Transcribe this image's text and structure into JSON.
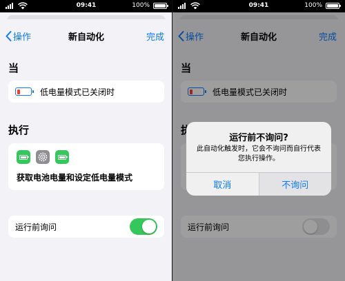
{
  "status_bar": {
    "time": "09:41",
    "battery_percent": "100%"
  },
  "nav": {
    "back_label": "操作",
    "title": "新自动化",
    "done_label": "完成"
  },
  "trigger_section": {
    "title": "当",
    "trigger_text": "低电量模式已关闭时"
  },
  "action_section": {
    "title": "执行",
    "action_text": "获取电池电量和设定低电量模式",
    "icons": [
      "battery-app-icon",
      "settings-gear-icon",
      "battery-app-icon"
    ]
  },
  "ask_before_running": {
    "label": "运行前询问",
    "left_state": "on",
    "right_state": "off"
  },
  "alert": {
    "title": "运行前不询问?",
    "message": "此自动化触发时，它会不询问而自行代表您执行操作。",
    "cancel_label": "取消",
    "confirm_label": "不询问"
  },
  "colors": {
    "accent": "#0a7aff",
    "toggle_on": "#34c759",
    "low_battery": "#ff3b30"
  }
}
